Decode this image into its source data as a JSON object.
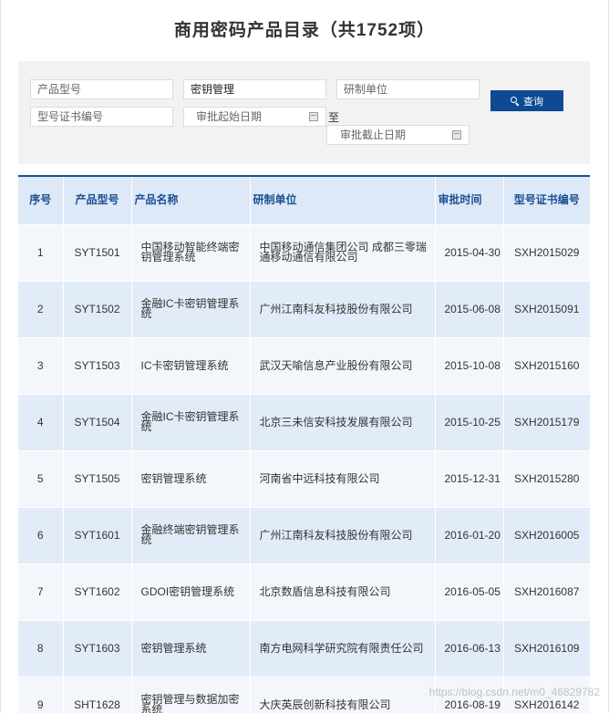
{
  "page": {
    "title": "商用密码产品目录（共1752项）"
  },
  "search": {
    "model_placeholder": "产品型号",
    "name_value": "密钥管理",
    "unit_placeholder": "研制单位",
    "cert_placeholder": "型号证书编号",
    "start_date_placeholder": "审批起始日期",
    "to_label": "至",
    "end_date_placeholder": "审批截止日期",
    "button_label": "查询",
    "button_color": "#0d4a93"
  },
  "table": {
    "headers": [
      "序号",
      "产品型号",
      "产品名称",
      "研制单位",
      "审批时间",
      "型号证书编号"
    ],
    "rows": [
      {
        "no": "1",
        "model": "SYT1501",
        "name": "中国移动智能终端密钥管理系统",
        "unit": "中国移动通信集团公司 成都三零瑞通移动通信有限公司",
        "date": "2015-04-30",
        "cert": "SXH2015029"
      },
      {
        "no": "2",
        "model": "SYT1502",
        "name": "金融IC卡密钥管理系统",
        "unit": "广州江南科友科技股份有限公司",
        "date": "2015-06-08",
        "cert": "SXH2015091"
      },
      {
        "no": "3",
        "model": "SYT1503",
        "name": "IC卡密钥管理系统",
        "unit": "武汉天喻信息产业股份有限公司",
        "date": "2015-10-08",
        "cert": "SXH2015160"
      },
      {
        "no": "4",
        "model": "SYT1504",
        "name": "金融IC卡密钥管理系统",
        "unit": "北京三未信安科技发展有限公司",
        "date": "2015-10-25",
        "cert": "SXH2015179"
      },
      {
        "no": "5",
        "model": "SYT1505",
        "name": "密钥管理系统",
        "unit": "河南省中远科技有限公司",
        "date": "2015-12-31",
        "cert": "SXH2015280"
      },
      {
        "no": "6",
        "model": "SYT1601",
        "name": "金融终端密钥管理系统",
        "unit": "广州江南科友科技股份有限公司",
        "date": "2016-01-20",
        "cert": "SXH2016005"
      },
      {
        "no": "7",
        "model": "SYT1602",
        "name": "GDOI密钥管理系统",
        "unit": "北京数盾信息科技有限公司",
        "date": "2016-05-05",
        "cert": "SXH2016087"
      },
      {
        "no": "8",
        "model": "SYT1603",
        "name": "密钥管理系统",
        "unit": "南方电网科学研究院有限责任公司",
        "date": "2016-06-13",
        "cert": "SXH2016109"
      },
      {
        "no": "9",
        "model": "SHT1628",
        "name": "密钥管理与数据加密系统",
        "unit": "大庆英辰创新科技有限公司",
        "date": "2016-08-19",
        "cert": "SXH2016142"
      }
    ]
  },
  "watermark": "https://blog.csdn.net/m0_46829782",
  "colors": {
    "header_bg": "#dde9f7",
    "header_text": "#1b4f93",
    "row_light": "#f3f7fc",
    "row_dark": "#e2ecf8"
  }
}
